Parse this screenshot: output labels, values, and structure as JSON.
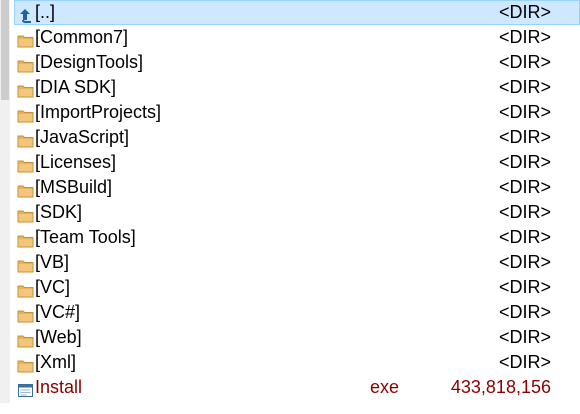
{
  "file_list": {
    "parent": {
      "name": "[..]",
      "size": "<DIR>",
      "icon": "up-arrow-icon"
    },
    "folders": [
      {
        "name": "[Common7]",
        "size": "<DIR>",
        "icon": "folder-icon"
      },
      {
        "name": "[DesignTools]",
        "size": "<DIR>",
        "icon": "folder-icon"
      },
      {
        "name": "[DIA SDK]",
        "size": "<DIR>",
        "icon": "folder-icon"
      },
      {
        "name": "[ImportProjects]",
        "size": "<DIR>",
        "icon": "folder-icon"
      },
      {
        "name": "[JavaScript]",
        "size": "<DIR>",
        "icon": "folder-icon"
      },
      {
        "name": "[Licenses]",
        "size": "<DIR>",
        "icon": "folder-icon"
      },
      {
        "name": "[MSBuild]",
        "size": "<DIR>",
        "icon": "folder-icon"
      },
      {
        "name": "[SDK]",
        "size": "<DIR>",
        "icon": "folder-icon"
      },
      {
        "name": "[Team Tools]",
        "size": "<DIR>",
        "icon": "folder-icon"
      },
      {
        "name": "[VB]",
        "size": "<DIR>",
        "icon": "folder-icon"
      },
      {
        "name": "[VC]",
        "size": "<DIR>",
        "icon": "folder-icon"
      },
      {
        "name": "[VC#]",
        "size": "<DIR>",
        "icon": "folder-icon"
      },
      {
        "name": "[Web]",
        "size": "<DIR>",
        "icon": "folder-icon"
      },
      {
        "name": "[Xml]",
        "size": "<DIR>",
        "icon": "folder-icon"
      }
    ],
    "files": [
      {
        "name": "Install",
        "ext": "exe",
        "size": "433,818,156",
        "icon": "executable-icon"
      }
    ]
  },
  "colors": {
    "selection_background": "#cde8ff",
    "selection_border": "#99d1ff",
    "file_text": "#8b0000",
    "folder_icon": "#e8b25a",
    "up_arrow": "#1f5fa8"
  }
}
